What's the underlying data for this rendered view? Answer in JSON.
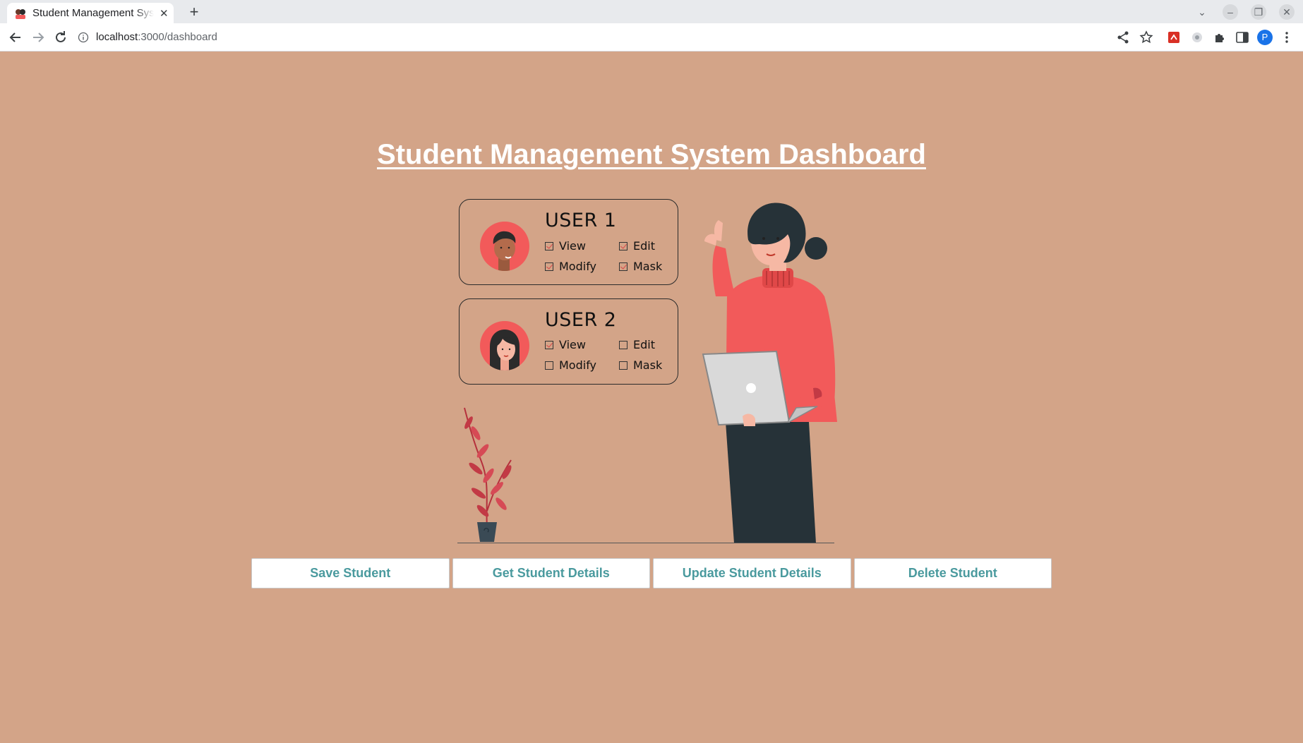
{
  "browser": {
    "tab_title": "Student Management System Dashboard",
    "url_host": "localhost",
    "url_path": ":3000/dashboard",
    "profile_initial": "P"
  },
  "page": {
    "title": "Student Management System Dashboard"
  },
  "users": [
    {
      "name": "USER 1",
      "permissions": [
        {
          "label": "View",
          "checked": true
        },
        {
          "label": "Edit",
          "checked": true
        },
        {
          "label": "Modify",
          "checked": true
        },
        {
          "label": "Mask",
          "checked": true
        }
      ]
    },
    {
      "name": "USER 2",
      "permissions": [
        {
          "label": "View",
          "checked": true
        },
        {
          "label": "Edit",
          "checked": false
        },
        {
          "label": "Modify",
          "checked": false
        },
        {
          "label": "Mask",
          "checked": false
        }
      ]
    }
  ],
  "actions": {
    "save": "Save Student",
    "get": "Get Student Details",
    "update": "Update Student Details",
    "delete": "Delete Student"
  },
  "colors": {
    "background": "#d3a488",
    "accent_red": "#f25a5a",
    "button_text": "#4a9a9e"
  }
}
